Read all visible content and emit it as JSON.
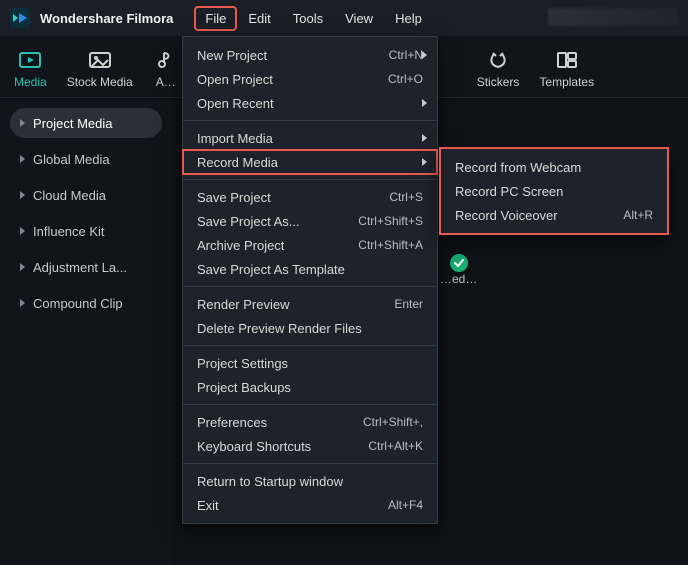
{
  "app": {
    "title": "Wondershare Filmora"
  },
  "menubar": {
    "items": [
      {
        "label": "File",
        "active": true
      },
      {
        "label": "Edit",
        "active": false
      },
      {
        "label": "Tools",
        "active": false
      },
      {
        "label": "View",
        "active": false
      },
      {
        "label": "Help",
        "active": false
      }
    ]
  },
  "toolbar": {
    "items": [
      {
        "label": "Media",
        "icon": "media-icon",
        "active": true
      },
      {
        "label": "Stock Media",
        "icon": "stock-icon",
        "active": false
      },
      {
        "label": "A…",
        "icon": "audio-icon",
        "active": false
      },
      {
        "label": "Stickers",
        "icon": "stickers-icon",
        "active": false
      },
      {
        "label": "Templates",
        "icon": "templates-icon",
        "active": false
      }
    ]
  },
  "sidebar": {
    "items": [
      {
        "label": "Project Media",
        "selected": true
      },
      {
        "label": "Global Media",
        "selected": false
      },
      {
        "label": "Cloud Media",
        "selected": false
      },
      {
        "label": "Influence Kit",
        "selected": false
      },
      {
        "label": "Adjustment La...",
        "selected": false
      },
      {
        "label": "Compound Clip",
        "selected": false
      }
    ]
  },
  "canvas": {
    "thumb_label": "…ed…"
  },
  "file_menu": {
    "groups": [
      [
        {
          "label": "New Project",
          "shortcut": "Ctrl+N",
          "has_sub": true,
          "highlight": false
        },
        {
          "label": "Open Project",
          "shortcut": "Ctrl+O",
          "has_sub": false,
          "highlight": false
        },
        {
          "label": "Open Recent",
          "shortcut": "",
          "has_sub": true,
          "highlight": false
        }
      ],
      [
        {
          "label": "Import Media",
          "shortcut": "",
          "has_sub": true,
          "highlight": false
        },
        {
          "label": "Record Media",
          "shortcut": "",
          "has_sub": true,
          "highlight": true
        }
      ],
      [
        {
          "label": "Save Project",
          "shortcut": "Ctrl+S",
          "has_sub": false,
          "highlight": false
        },
        {
          "label": "Save Project As...",
          "shortcut": "Ctrl+Shift+S",
          "has_sub": false,
          "highlight": false
        },
        {
          "label": "Archive Project",
          "shortcut": "Ctrl+Shift+A",
          "has_sub": false,
          "highlight": false
        },
        {
          "label": "Save Project As Template",
          "shortcut": "",
          "has_sub": false,
          "highlight": false
        }
      ],
      [
        {
          "label": "Render Preview",
          "shortcut": "Enter",
          "has_sub": false,
          "highlight": false
        },
        {
          "label": "Delete Preview Render Files",
          "shortcut": "",
          "has_sub": false,
          "highlight": false
        }
      ],
      [
        {
          "label": "Project Settings",
          "shortcut": "",
          "has_sub": false,
          "highlight": false
        },
        {
          "label": "Project Backups",
          "shortcut": "",
          "has_sub": false,
          "highlight": false
        }
      ],
      [
        {
          "label": "Preferences",
          "shortcut": "Ctrl+Shift+,",
          "has_sub": false,
          "highlight": false
        },
        {
          "label": "Keyboard Shortcuts",
          "shortcut": "Ctrl+Alt+K",
          "has_sub": false,
          "highlight": false
        }
      ],
      [
        {
          "label": "Return to Startup window",
          "shortcut": "",
          "has_sub": false,
          "highlight": false
        },
        {
          "label": "Exit",
          "shortcut": "Alt+F4",
          "has_sub": false,
          "highlight": false
        }
      ]
    ]
  },
  "record_submenu": {
    "items": [
      {
        "label": "Record from Webcam",
        "shortcut": ""
      },
      {
        "label": "Record PC Screen",
        "shortcut": ""
      },
      {
        "label": "Record Voiceover",
        "shortcut": "Alt+R"
      }
    ]
  }
}
